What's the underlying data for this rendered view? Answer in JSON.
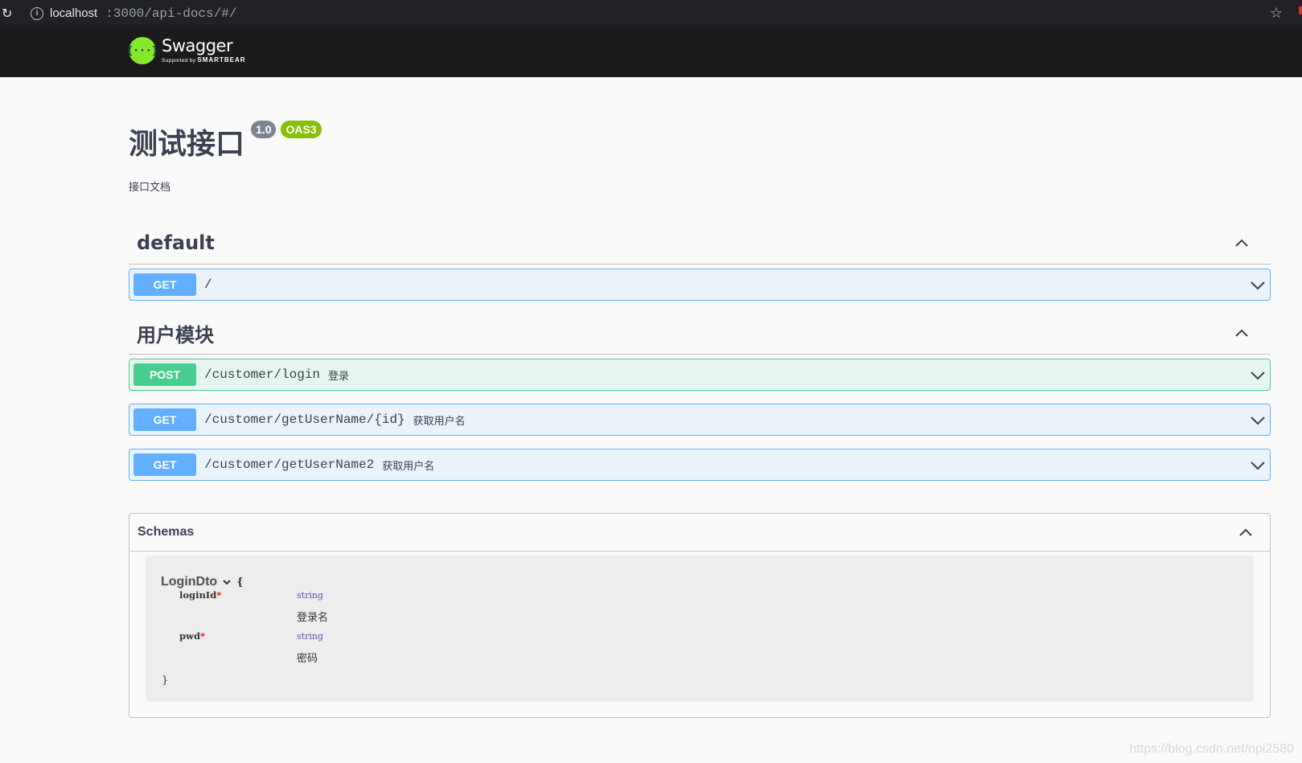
{
  "browser": {
    "host": "localhost",
    "path": ":3000/api-docs/#/"
  },
  "topbar": {
    "logo_name": "Swagger",
    "logo_supported": "Supported by",
    "logo_brand": "SMARTBEAR",
    "logo_glyph": "{···}"
  },
  "info": {
    "title": "测试接口",
    "version": "1.0",
    "oas": "OAS3",
    "description": "接口文档"
  },
  "tags": [
    {
      "name": "default",
      "operations": [
        {
          "method": "GET",
          "path": "/",
          "summary": ""
        }
      ]
    },
    {
      "name": "用户模块",
      "operations": [
        {
          "method": "POST",
          "path": "/customer/login",
          "summary": "登录"
        },
        {
          "method": "GET",
          "path": "/customer/getUserName/{id}",
          "summary": "获取用户名"
        },
        {
          "method": "GET",
          "path": "/customer/getUserName2",
          "summary": "获取用户名"
        }
      ]
    }
  ],
  "schemas": {
    "label": "Schemas",
    "model": {
      "name": "LoginDto",
      "open_brace": "{",
      "close_brace": "}",
      "properties": [
        {
          "name": "loginId",
          "required": "*",
          "type": "string",
          "description": "登录名"
        },
        {
          "name": "pwd",
          "required": "*",
          "type": "string",
          "description": "密码"
        }
      ]
    }
  },
  "watermark": "https://blog.csdn.net/npi2580",
  "colors": {
    "get": "#61affe",
    "post": "#49cc90",
    "topbar": "#1b1b1b",
    "logo": "#85ea2d",
    "oas_badge": "#89bf04",
    "version_badge": "#7d8492"
  },
  "icons": [
    "reload-icon",
    "info-icon",
    "star-icon",
    "chevron-up-icon",
    "chevron-down-icon"
  ]
}
